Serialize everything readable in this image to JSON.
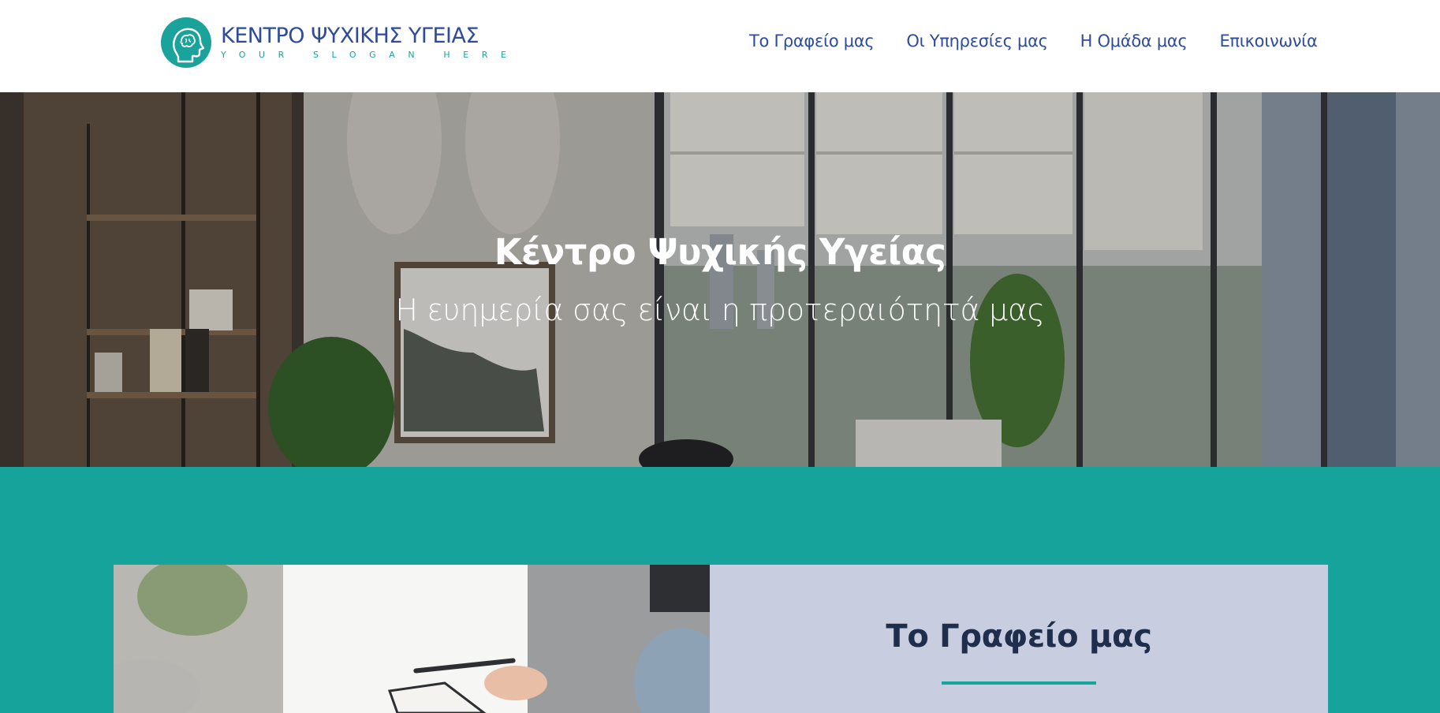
{
  "brand": {
    "title": "ΚΕΝΤΡΟ ΨΥΧΙΚΗΣ ΥΓΕΙΑΣ",
    "slogan": "YOUR SLOGAN HERE",
    "logo_icon": "head-brain-icon",
    "accent_color": "#16a39b",
    "primary_color": "#2e4b9c"
  },
  "nav": {
    "items": [
      {
        "label": "Το Γραφείο μας"
      },
      {
        "label": "Οι Υπηρεσίες μας"
      },
      {
        "label": "Η Ομάδα μας"
      },
      {
        "label": "Επικοινωνία"
      }
    ]
  },
  "hero": {
    "title": "Κέντρο Ψυχικής Υγείας",
    "subtitle": "Η ευημερία σας είναι η προτεραιότητά μας"
  },
  "office_section": {
    "heading": "Το Γραφείο μας",
    "background_color": "#16a39b",
    "panel_color": "#c8cde0"
  }
}
